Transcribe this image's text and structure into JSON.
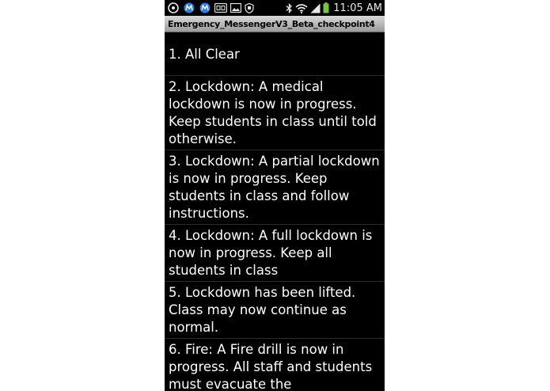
{
  "status_bar": {
    "time": "11:05 AM",
    "icons": [
      "notification-icon",
      "app-icon",
      "app-icon",
      "cc-icon",
      "image-icon",
      "shield-icon",
      "bluetooth-icon",
      "wifi-icon",
      "signal-icon",
      "battery-icon"
    ],
    "colors": {
      "battery": "#76c442",
      "text": "#e8e8e8",
      "app_icon": "#2f7fd6"
    }
  },
  "title_bar": {
    "title": "Emergency_MessengerV3_Beta_checkpoint4"
  },
  "messages": [
    "1. All Clear",
    "2. Lockdown: A medical lockdown is now in progress. Keep students in class until told otherwise.",
    "3. Lockdown: A partial lockdown is now in progress. Keep students in class and follow instructions.",
    "4. Lockdown: A full lockdown is now in progress. Keep all students in class",
    "5. Lockdown has been lifted. Class may now continue as normal.",
    "6. Fire: A Fire drill is now in progress. All staff and students must evacuate the"
  ]
}
